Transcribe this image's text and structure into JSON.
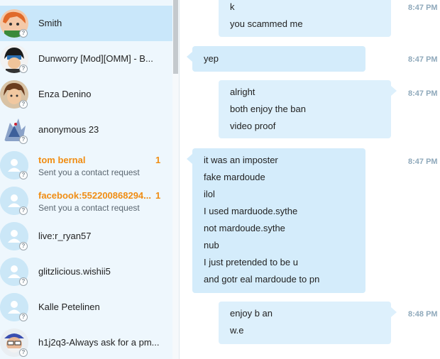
{
  "colors": {
    "sidebar_bg": "#eef7fd",
    "selected_bg": "#c9e7fa",
    "request_accent": "#f08d13",
    "bubble_outgoing": "#ddf0fc",
    "bubble_incoming": "#d4ecfb",
    "timestamp": "#8fa9bb"
  },
  "contacts": [
    {
      "name": "Smith",
      "avatar": "orange-haired-character-avatar",
      "status_icon": "?"
    },
    {
      "name": "Dunworry [Mod][OMM] - B...",
      "avatar": "masked-character-avatar",
      "status_icon": "?"
    },
    {
      "name": "Enza Denino",
      "avatar": "brown-haired-character-avatar",
      "status_icon": "?"
    },
    {
      "name": "anonymous 23",
      "avatar": "dragon-avatar",
      "status_icon": "?"
    },
    {
      "name": "tom bernal",
      "subtitle": "Sent you a contact request",
      "count": "1",
      "avatar": "default-person-avatar",
      "status_icon": "?"
    },
    {
      "name": "facebook:552200868294...",
      "subtitle": "Sent you a contact request",
      "count": "1",
      "avatar": "default-person-avatar",
      "status_icon": "?"
    },
    {
      "name": "live:r_ryan57",
      "avatar": "default-person-avatar",
      "status_icon": "?"
    },
    {
      "name": "glitzlicious.wishii5",
      "avatar": "default-person-avatar",
      "status_icon": "?"
    },
    {
      "name": "Kalle Petelinen",
      "avatar": "default-person-avatar",
      "status_icon": "?"
    },
    {
      "name": "h1j2q3-Always ask for a pm...",
      "avatar": "old-man-avatar",
      "status_icon": "?"
    }
  ],
  "messages": [
    {
      "direction": "outgoing",
      "lines": [
        "k",
        "you scammed me"
      ],
      "time": "8:47 PM"
    },
    {
      "direction": "incoming",
      "lines": [
        "yep"
      ],
      "time": "8:47 PM"
    },
    {
      "direction": "outgoing",
      "lines": [
        "alright",
        "both enjoy the ban",
        "video proof"
      ],
      "time": "8:47 PM"
    },
    {
      "direction": "incoming",
      "lines": [
        "it was an imposter",
        "fake mardoude",
        "ilol",
        "I used marduode.sythe",
        "not mardoude.sythe",
        "nub",
        "I just pretended to be u",
        "and gotr eal mardoude to pn"
      ],
      "time": "8:47 PM"
    },
    {
      "direction": "outgoing",
      "lines": [
        "enjoy b an",
        "w.e"
      ],
      "time": "8:48 PM"
    }
  ]
}
